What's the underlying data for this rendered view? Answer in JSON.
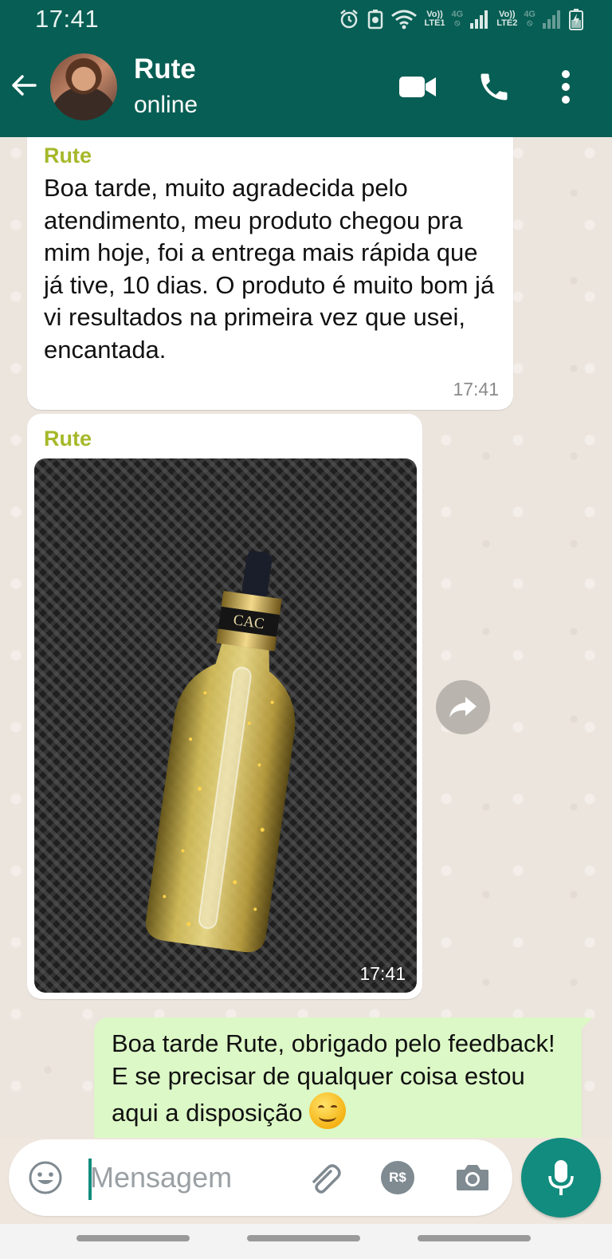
{
  "status_bar": {
    "time": "17:41",
    "sim1_tag_top": "Vo))",
    "sim1_tag_bottom": "LTE1",
    "sim1_network": "4G",
    "sim2_tag_top": "Vo))",
    "sim2_tag_bottom": "LTE2",
    "sim2_network": "4G"
  },
  "header": {
    "contact_name": "Rute",
    "contact_status": "online"
  },
  "messages": [
    {
      "sender": "Rute",
      "text": "Boa tarde, muito agradecida pelo atendimento, meu produto chegou pra mim hoje, foi a entrega mais rápida que já tive, 10 dias. O produto é muito bom já vi resultados na primeira vez que usei, encantada.",
      "time": "17:41"
    },
    {
      "sender": "Rute",
      "photo_label": "CAC",
      "time": "17:41"
    },
    {
      "text": "Boa tarde Rute, obrigado pelo feedback! E se precisar de qualquer coisa estou aqui a disposição",
      "emoji": "smiling-face-emoji"
    }
  ],
  "input": {
    "placeholder": "Mensagem",
    "payment_badge": "R$"
  },
  "colors": {
    "header_bg": "#075e54",
    "sender_name": "#a6b82a",
    "outgoing_bubble": "#dcf8c6",
    "mic_button": "#128c7e"
  }
}
